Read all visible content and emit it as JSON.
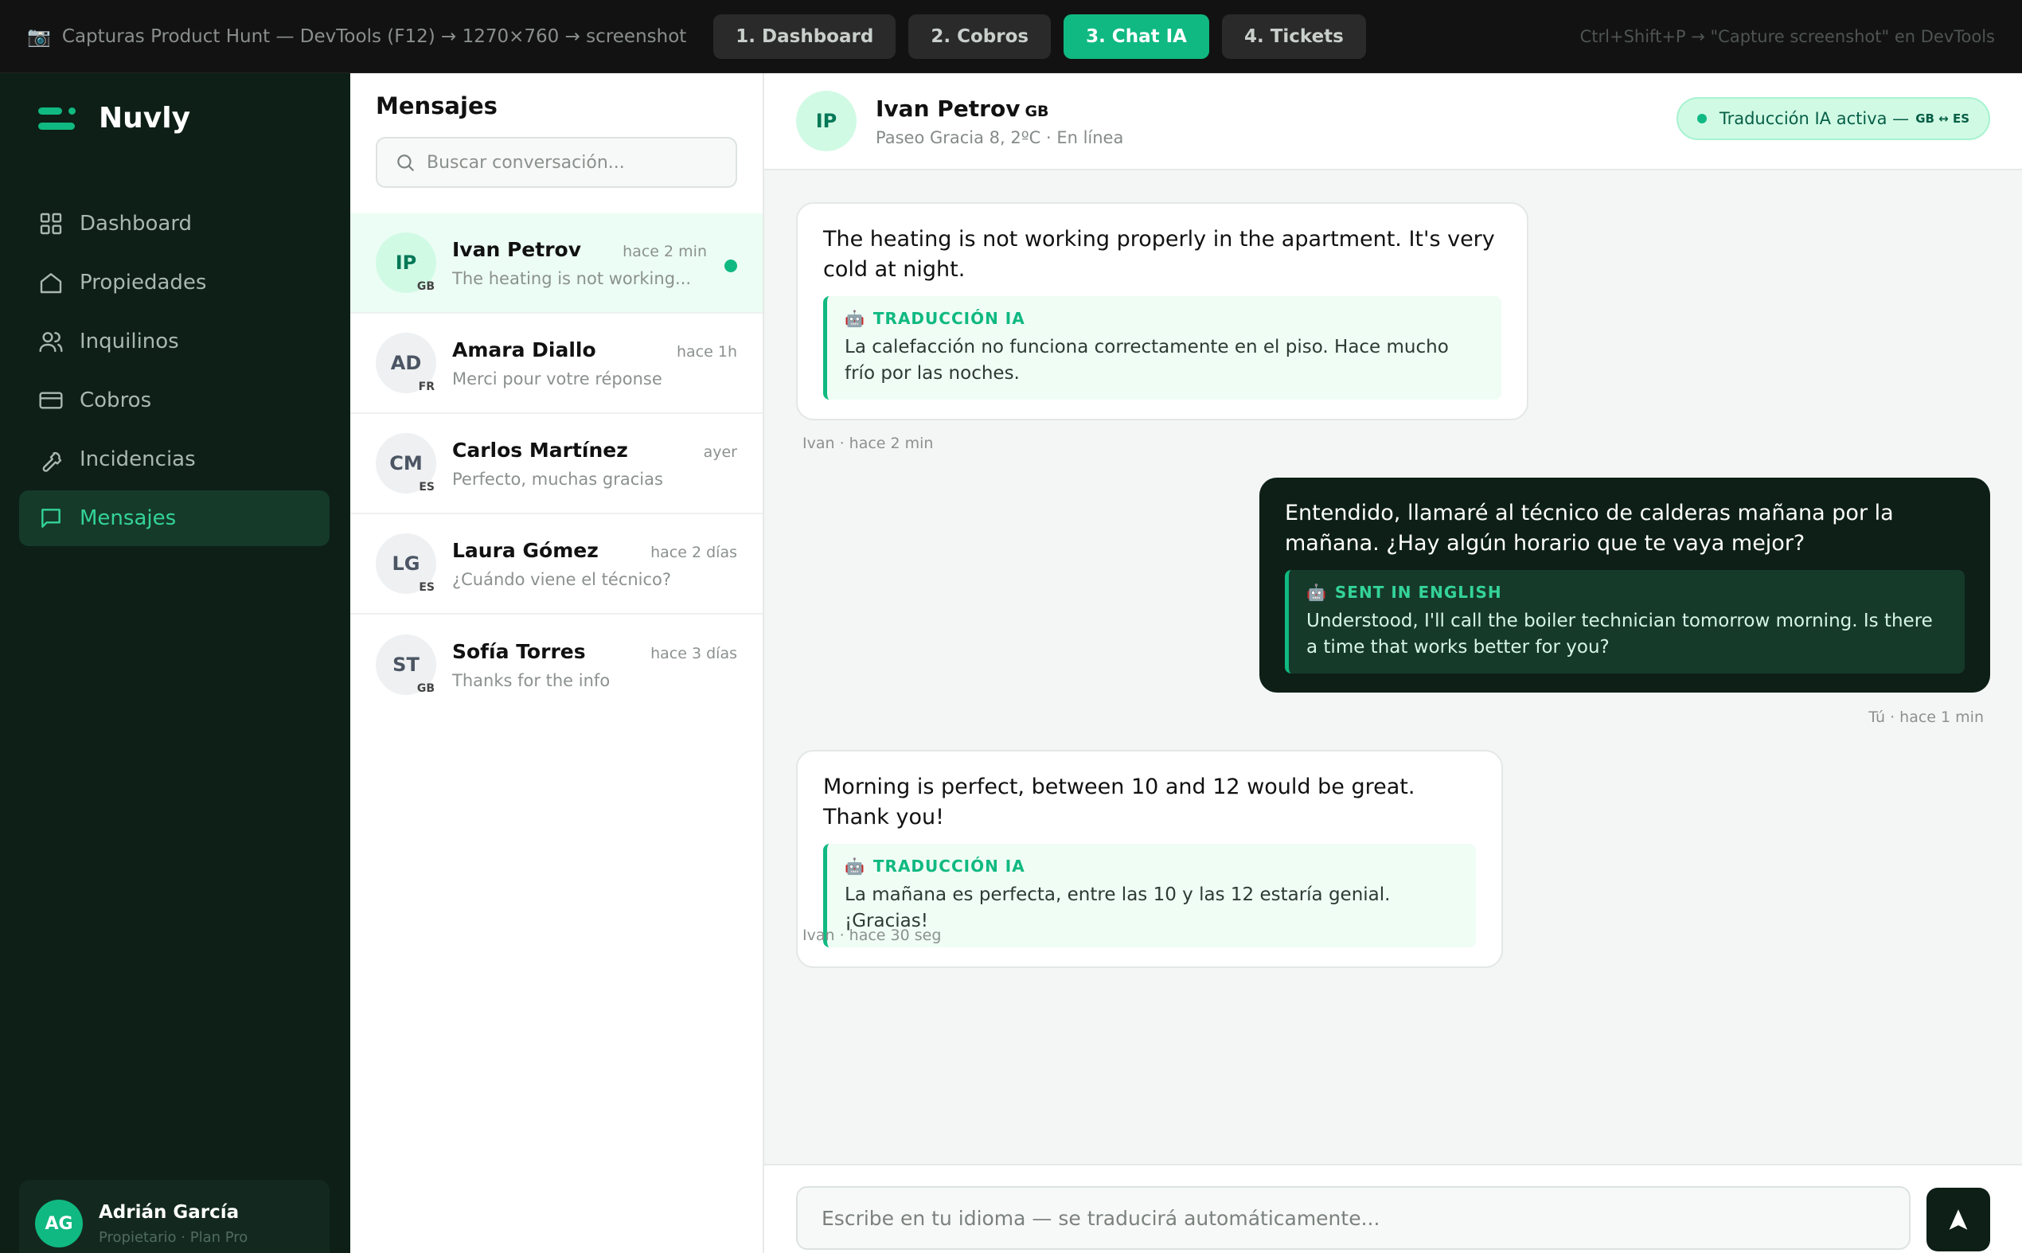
{
  "capture_bar": {
    "title": "Capturas Product Hunt — DevTools (F12) → 1270×760 → screenshot",
    "steps": [
      "1. Dashboard",
      "2. Cobros",
      "3. Chat IA",
      "4. Tickets"
    ],
    "active_step": 2,
    "hint": "Ctrl+Shift+P → \"Capture screenshot\" en DevTools"
  },
  "sidebar": {
    "brand": "Nuvly",
    "items": [
      {
        "label": "Dashboard",
        "icon": "grid-icon"
      },
      {
        "label": "Propiedades",
        "icon": "home-icon"
      },
      {
        "label": "Inquilinos",
        "icon": "users-icon"
      },
      {
        "label": "Cobros",
        "icon": "credit-card-icon"
      },
      {
        "label": "Incidencias",
        "icon": "wrench-icon"
      },
      {
        "label": "Mensajes",
        "icon": "message-icon"
      }
    ],
    "active_item": 5,
    "user": {
      "initials": "AG",
      "name": "Adrián García",
      "role": "Propietario · Plan Pro"
    }
  },
  "conversations": {
    "title": "Mensajes",
    "search_placeholder": "Buscar conversación...",
    "items": [
      {
        "initials": "IP",
        "flag": "GB",
        "name": "Ivan Petrov",
        "time": "hace 2 min",
        "preview": "The heating is not working...",
        "online": true
      },
      {
        "initials": "AD",
        "flag": "FR",
        "name": "Amara Diallo",
        "time": "hace 1h",
        "preview": "Merci pour votre réponse"
      },
      {
        "initials": "CM",
        "flag": "ES",
        "name": "Carlos Martínez",
        "time": "ayer",
        "preview": "Perfecto, muchas gracias"
      },
      {
        "initials": "LG",
        "flag": "ES",
        "name": "Laura Gómez",
        "time": "hace 2 días",
        "preview": "¿Cuándo viene el técnico?"
      },
      {
        "initials": "ST",
        "flag": "GB",
        "name": "Sofía Torres",
        "time": "hace 3 días",
        "preview": "Thanks for the info"
      }
    ]
  },
  "chat": {
    "contact": {
      "initials": "IP",
      "name": "Ivan Petrov",
      "country": "GB",
      "subtitle": "Paseo Gracia 8, 2ºC · En línea"
    },
    "translation_badge": {
      "label": "Traducción IA activa —",
      "langs": "GB ↔ ES"
    },
    "messages": [
      {
        "direction": "in",
        "text": "The heating is not working properly in the apartment. It's very cold at night.",
        "translation_label": "TRADUCCIÓN IA",
        "translation": "La calefacción no funciona correctamente en el piso. Hace mucho frío por las noches.",
        "meta": "Ivan · hace 2 min"
      },
      {
        "direction": "out",
        "text": "Entendido, llamaré al técnico de calderas mañana por la mañana. ¿Hay algún horario que te vaya mejor?",
        "translation_label": "SENT IN ENGLISH",
        "translation": "Understood, I'll call the boiler technician tomorrow morning. Is there a time that works better for you?",
        "meta": "Tú · hace 1 min"
      },
      {
        "direction": "in",
        "text": "Morning is perfect, between 10 and 12 would be great. Thank you!",
        "translation_label": "TRADUCCIÓN IA",
        "translation": "La mañana es perfecta, entre las 10 y las 12 estaría genial. ¡Gracias!",
        "meta": "Ivan · hace 30 seg"
      }
    ],
    "composer_placeholder": "Escribe en tu idioma — se traducirá automáticamente..."
  },
  "colors": {
    "accent": "#10b981",
    "sidebar_bg": "#0d1f17",
    "out_bubble": "#0d1f17"
  }
}
